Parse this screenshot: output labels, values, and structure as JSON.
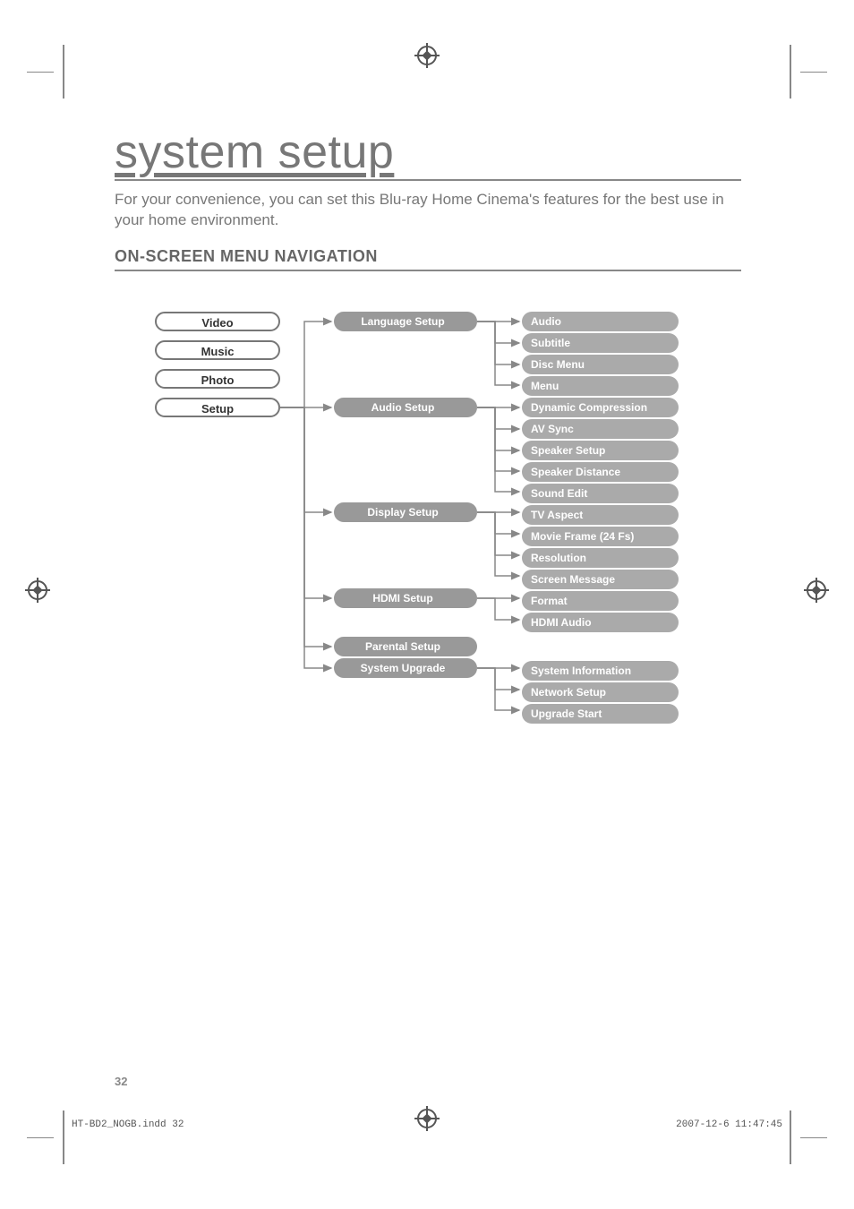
{
  "title": "system setup",
  "intro": "For your convenience, you can set this Blu-ray Home Cinema's features for the best use in your home environment.",
  "section": "ON-SCREEN MENU NAVIGATION",
  "col1": {
    "video": "Video",
    "music": "Music",
    "photo": "Photo",
    "setup": "Setup"
  },
  "col2": {
    "language": "Language Setup",
    "audio": "Audio Setup",
    "display": "Display Setup",
    "hdmi": "HDMI Setup",
    "parental": "Parental Setup",
    "upgrade": "System Upgrade"
  },
  "col3": {
    "lang_audio": "Audio",
    "lang_subtitle": "Subtitle",
    "lang_discmenu": "Disc Menu",
    "lang_menu": "Menu",
    "aud_dyncomp": "Dynamic Compression",
    "aud_avsync": "AV Sync",
    "aud_speaker": "Speaker Setup",
    "aud_distance": "Speaker Distance",
    "aud_soundedit": "Sound Edit",
    "disp_tvaspect": "TV Aspect",
    "disp_movieframe": "Movie Frame (24 Fs)",
    "disp_resolution": "Resolution",
    "disp_screenmsg": "Screen Message",
    "hdmi_format": "Format",
    "hdmi_audio": "HDMI Audio",
    "upg_sysinfo": "System Information",
    "upg_network": "Network Setup",
    "upg_start": "Upgrade Start"
  },
  "page_number": "32",
  "footer_left": "HT-BD2_NOGB.indd   32",
  "footer_right": "2007-12-6   11:47:45"
}
